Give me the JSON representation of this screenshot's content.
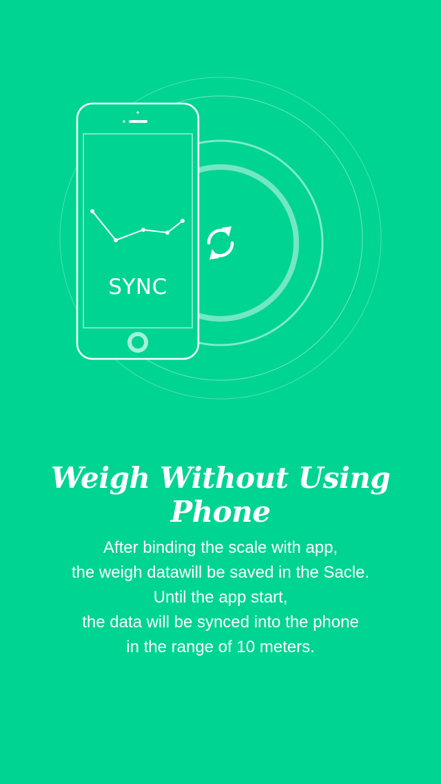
{
  "theme": {
    "background": "#00d492",
    "foreground": "#ffffff"
  },
  "illustration": {
    "sync_label": "SYNC",
    "center_icon": "sync-arrows-icon"
  },
  "headline": "Weigh Without Using Phone",
  "description": {
    "lines": [
      "After binding the scale with app,",
      "the weigh datawill be saved in the Sacle.",
      "Until the app start,",
      "the data will be synced into the phone",
      "in the range of 10 meters."
    ]
  }
}
